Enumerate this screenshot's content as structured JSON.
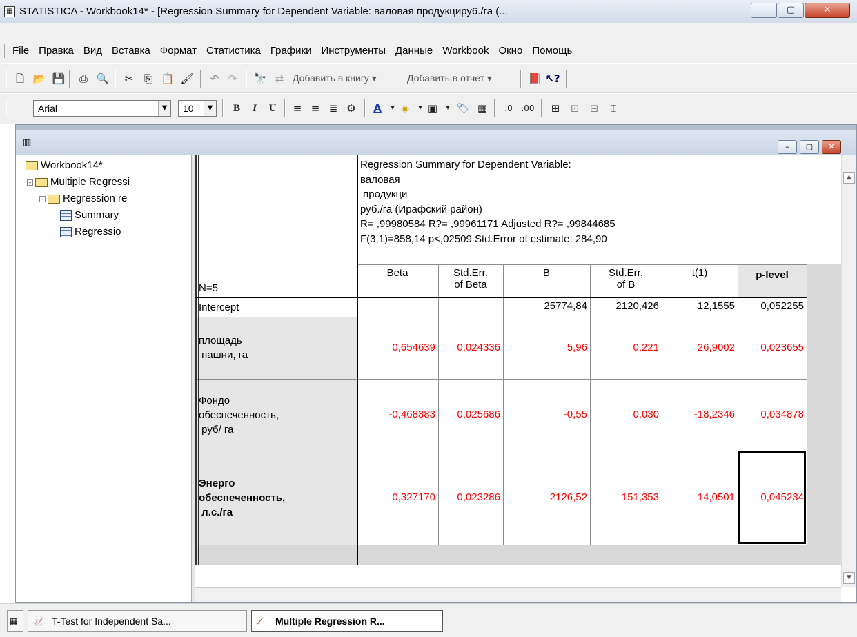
{
  "window": {
    "title": "STATISTICA - Workbook14* - [Regression Summary for Dependent Variable: валовая продукциру6./га (...",
    "app_icon": "statistica-icon",
    "controls": [
      "minimize",
      "maximize",
      "close"
    ]
  },
  "menu": [
    "File",
    "Правка",
    "Вид",
    "Вставка",
    "Формат",
    "Статистика",
    "Графики",
    "Инструменты",
    "Данные",
    "Workbook",
    "Окно",
    "Помощь"
  ],
  "toolbar": {
    "add_to_workbook": "Добавить в книгу ▾",
    "add_to_report": "Добавить в отчет ▾",
    "font_name": "Arial",
    "font_size": "10",
    "bold": "B",
    "italic": "I",
    "underline": "U",
    "font_color": "A"
  },
  "tree": {
    "root": "Workbook14*",
    "nodes": [
      "Multiple Regressi",
      "Regression re",
      "Summary",
      "Regressio"
    ]
  },
  "table": {
    "header_lines": [
      "Regression Summary for Dependent Variable:",
      "валовая",
      " продукци",
      "руб./га (Ирафский район)",
      "R= ,99980584 R?= ,99961171 Adjusted R?= ,99844685",
      "F(3,1)=858,14 p<,02509 Std.Error of estimate: 284,90"
    ],
    "n_label": "N=5",
    "columns": [
      {
        "line1": "Beta",
        "line2": ""
      },
      {
        "line1": "Std.Err.",
        "line2": "of Beta"
      },
      {
        "line1": "B",
        "line2": ""
      },
      {
        "line1": "Std.Err.",
        "line2": "of B"
      },
      {
        "line1": "t(1)",
        "line2": ""
      },
      {
        "line1": "p-level",
        "line2": ""
      }
    ],
    "rows": [
      {
        "label": [
          "Intercept"
        ],
        "values": [
          "",
          "",
          "25774,84",
          "2120,426",
          "12,1555",
          "0,052255"
        ],
        "red": false,
        "bold": false
      },
      {
        "label": [
          "площадь",
          " пашни, га"
        ],
        "values": [
          "0,654639",
          "0,024336",
          "5,96",
          "0,221",
          "26,9002",
          "0,023655"
        ],
        "red": true,
        "bold": false
      },
      {
        "label": [
          "Фондо",
          "обеспеченность,",
          " руб/ га"
        ],
        "values": [
          "-0,468383",
          "0,025686",
          "-0,55",
          "0,030",
          "-18,2346",
          "0,034878"
        ],
        "red": true,
        "bold": false
      },
      {
        "label": [
          "Энерго",
          "обеспеченность,",
          " л.с./га"
        ],
        "values": [
          "0,327170",
          "0,023286",
          "2126,52",
          "151,353",
          "14,0501",
          "0,045234"
        ],
        "red": true,
        "bold": true
      }
    ],
    "value_color": "#ff0000"
  },
  "taskbar": {
    "items": [
      "T-Test for Independent Sa...",
      "Multiple Regression R..."
    ]
  }
}
